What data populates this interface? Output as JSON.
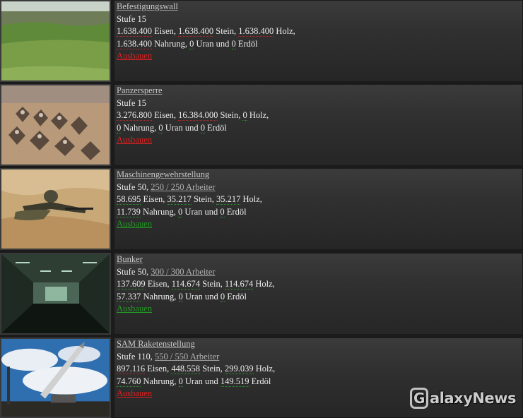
{
  "buildings": [
    {
      "name": "Befestigungswall",
      "level": "Stufe 15",
      "workers": "",
      "res": [
        {
          "v": "1.638.400",
          "t": " Eisen",
          "ok": false,
          "sep": ", "
        },
        {
          "v": "1.638.400",
          "t": " Stein",
          "ok": false,
          "sep": ", "
        },
        {
          "v": "1.638.400",
          "t": " Holz",
          "ok": false,
          "sep": ","
        },
        {
          "v": "1.638.400",
          "t": " Nahrung",
          "ok": false,
          "sep": ", "
        },
        {
          "v": "0",
          "t": " Uran",
          "ok": true,
          "sep": " und "
        },
        {
          "v": "0",
          "t": " Erdöl",
          "ok": true,
          "sep": ""
        }
      ],
      "action": "Ausbauen",
      "action_ok": false
    },
    {
      "name": "Panzersperre",
      "level": "Stufe 15",
      "workers": "",
      "res": [
        {
          "v": "3.276.800",
          "t": " Eisen",
          "ok": false,
          "sep": ", "
        },
        {
          "v": "16.384.000",
          "t": " Stein",
          "ok": false,
          "sep": ", "
        },
        {
          "v": "0",
          "t": " Holz",
          "ok": true,
          "sep": ","
        },
        {
          "v": "0",
          "t": " Nahrung",
          "ok": true,
          "sep": ", "
        },
        {
          "v": "0",
          "t": " Uran",
          "ok": true,
          "sep": " und "
        },
        {
          "v": "0",
          "t": " Erdöl",
          "ok": true,
          "sep": ""
        }
      ],
      "action": "Ausbauen",
      "action_ok": false
    },
    {
      "name": "Maschinengewehrstellung",
      "level": "Stufe 50",
      "workers": "250 / 250 Arbeiter",
      "res": [
        {
          "v": "58.695",
          "t": " Eisen",
          "ok": true,
          "sep": ", "
        },
        {
          "v": "35.217",
          "t": " Stein",
          "ok": true,
          "sep": ", "
        },
        {
          "v": "35.217",
          "t": " Holz",
          "ok": true,
          "sep": ","
        },
        {
          "v": "11.739",
          "t": " Nahrung",
          "ok": true,
          "sep": ", "
        },
        {
          "v": "0",
          "t": " Uran",
          "ok": true,
          "sep": " und "
        },
        {
          "v": "0",
          "t": " Erdöl",
          "ok": true,
          "sep": ""
        }
      ],
      "action": "Ausbauen",
      "action_ok": true
    },
    {
      "name": "Bunker",
      "level": "Stufe 50",
      "workers": "300 / 300 Arbeiter",
      "res": [
        {
          "v": "137.609",
          "t": " Eisen",
          "ok": true,
          "sep": ", "
        },
        {
          "v": "114.674",
          "t": " Stein",
          "ok": true,
          "sep": ", "
        },
        {
          "v": "114.674",
          "t": " Holz",
          "ok": true,
          "sep": ","
        },
        {
          "v": "57.337",
          "t": " Nahrung",
          "ok": true,
          "sep": ", "
        },
        {
          "v": "0",
          "t": " Uran",
          "ok": true,
          "sep": " und "
        },
        {
          "v": "0",
          "t": " Erdöl",
          "ok": true,
          "sep": ""
        }
      ],
      "action": "Ausbauen",
      "action_ok": true
    },
    {
      "name": "SAM Raketenstellung",
      "level": "Stufe 110",
      "workers": "550 / 550 Arbeiter",
      "res": [
        {
          "v": "897.116",
          "t": " Eisen",
          "ok": false,
          "sep": ", "
        },
        {
          "v": "448.558",
          "t": " Stein",
          "ok": true,
          "sep": ", "
        },
        {
          "v": "299.039",
          "t": " Holz",
          "ok": true,
          "sep": ","
        },
        {
          "v": "74.760",
          "t": " Nahrung",
          "ok": true,
          "sep": ", "
        },
        {
          "v": "0",
          "t": " Uran",
          "ok": true,
          "sep": " und "
        },
        {
          "v": "149.519",
          "t": " Erdöl",
          "ok": true,
          "sep": ""
        }
      ],
      "action": "Ausbauen",
      "action_ok": false
    }
  ],
  "watermark": "GalaxyNews",
  "colors": {
    "ok": "#239b23",
    "missing": "#e02020"
  }
}
